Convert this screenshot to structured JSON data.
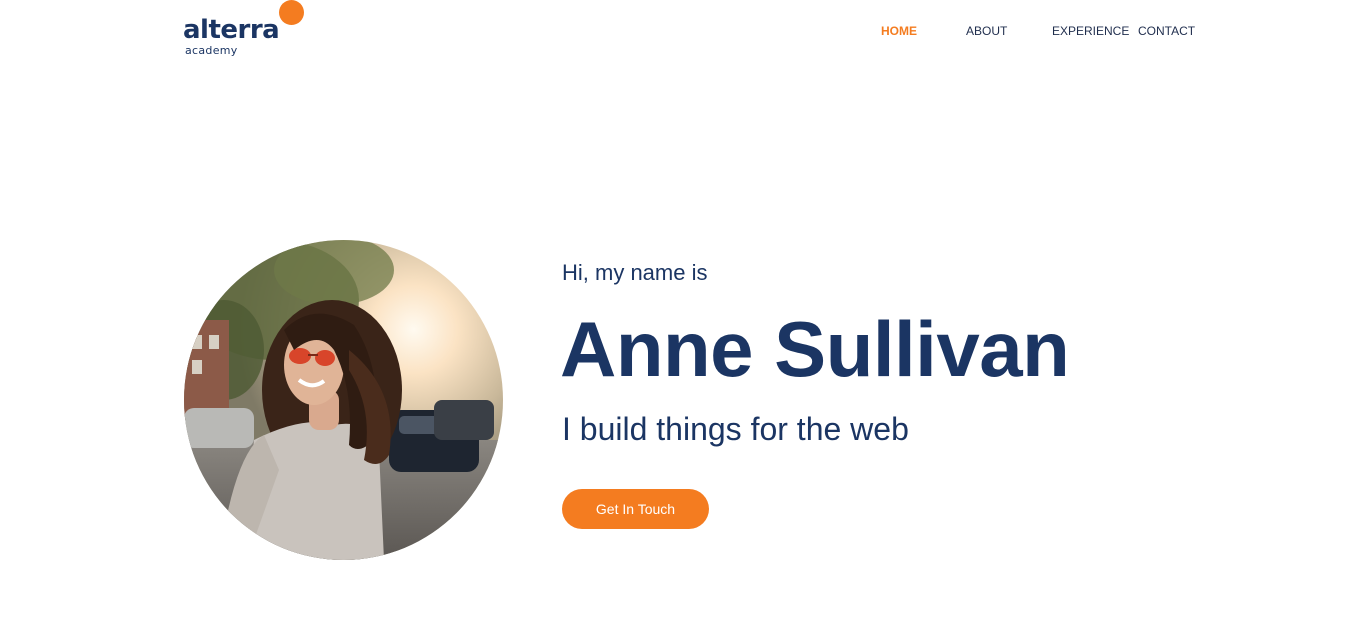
{
  "brand": {
    "name": "alterra",
    "sub": "academy",
    "colors": {
      "primary": "#1b3563",
      "accent": "#f47c20"
    }
  },
  "nav": {
    "items": [
      {
        "label": "HOME",
        "active": true
      },
      {
        "label": "ABOUT",
        "active": false
      },
      {
        "label": "EXPERIENCE",
        "active": false
      },
      {
        "label": "CONTACT",
        "active": false
      }
    ]
  },
  "hero": {
    "greeting": "Hi, my name is",
    "name": "Anne Sullivan",
    "tagline": "I build things for the web",
    "cta_label": "Get In Touch",
    "avatar_icon": "profile-photo"
  }
}
